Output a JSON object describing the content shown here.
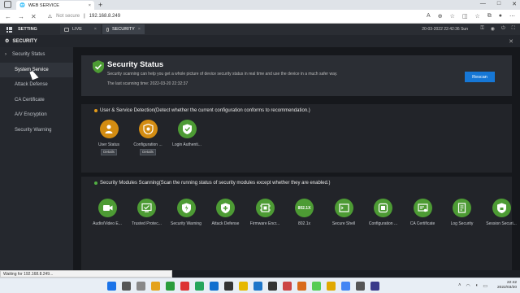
{
  "browser": {
    "tab_title": "WEB SERVICE",
    "tab_close": "×",
    "new_tab": "+",
    "not_secure": "Not secure",
    "url": "192.168.8.249",
    "window_controls": [
      "—",
      "□",
      "✕"
    ]
  },
  "app": {
    "setting_label": "SETTING",
    "tabs": [
      {
        "label": "LIVE"
      },
      {
        "label": "SECURITY"
      }
    ],
    "datetime": "20-03-2022 22:42:36 Sun",
    "page_title": "SECURITY"
  },
  "sidebar": {
    "items": [
      {
        "label": "Security Status"
      },
      {
        "label": "System Service"
      },
      {
        "label": "Attack Defense"
      },
      {
        "label": "CA Certificate"
      },
      {
        "label": "A/V Encryption"
      },
      {
        "label": "Security Warning"
      }
    ]
  },
  "status": {
    "title": "Security Status",
    "description": "Security scanning can help you get a whole picture of device security status in real time and use the device in a much safer way.",
    "last_scan": "The last scanning time: 2022-03-20 22:32:37",
    "rescan_label": "Rescan"
  },
  "user_detection": {
    "heading": "User & Service Detection(Detect whether the current configuration conforms to recommendation.)",
    "items": [
      {
        "label": "User Status",
        "details": "Details",
        "status_color": "#d38c12",
        "icon": "user-icon"
      },
      {
        "label": "Configuration ...",
        "details": "Details",
        "status_color": "#d38c12",
        "icon": "gear-shield-icon"
      },
      {
        "label": "Login Authenti...",
        "status_color": "#4d9b34",
        "icon": "check-shield-icon"
      }
    ]
  },
  "modules": {
    "heading": "Security Modules Scanning(Scan the running status of security modules except whether they are enabled.)",
    "items": [
      {
        "label": "Audio/Video E...",
        "icon": "video-icon"
      },
      {
        "label": "Trusted Protec...",
        "icon": "monitor-check-icon"
      },
      {
        "label": "Security Warning",
        "icon": "warning-shield-icon"
      },
      {
        "label": "Attack Defense",
        "icon": "shield-plus-icon"
      },
      {
        "label": "Firmware Encr...",
        "icon": "firmware-icon"
      },
      {
        "label": "802.1x",
        "icon": "8021x-icon",
        "icon_text": "802.1X"
      },
      {
        "label": "Secure Shell",
        "icon": "terminal-icon"
      },
      {
        "label": "Configuration ...",
        "icon": "config-icon"
      },
      {
        "label": "CA Certificate",
        "icon": "certificate-icon"
      },
      {
        "label": "Log Security",
        "icon": "log-icon"
      },
      {
        "label": "Session Securi...",
        "icon": "session-shield-icon"
      }
    ]
  },
  "statusbar": {
    "text": "Waiting for 192.168.8.249..."
  },
  "taskbar": {
    "time": "22:42",
    "date": "2022/03/20"
  }
}
